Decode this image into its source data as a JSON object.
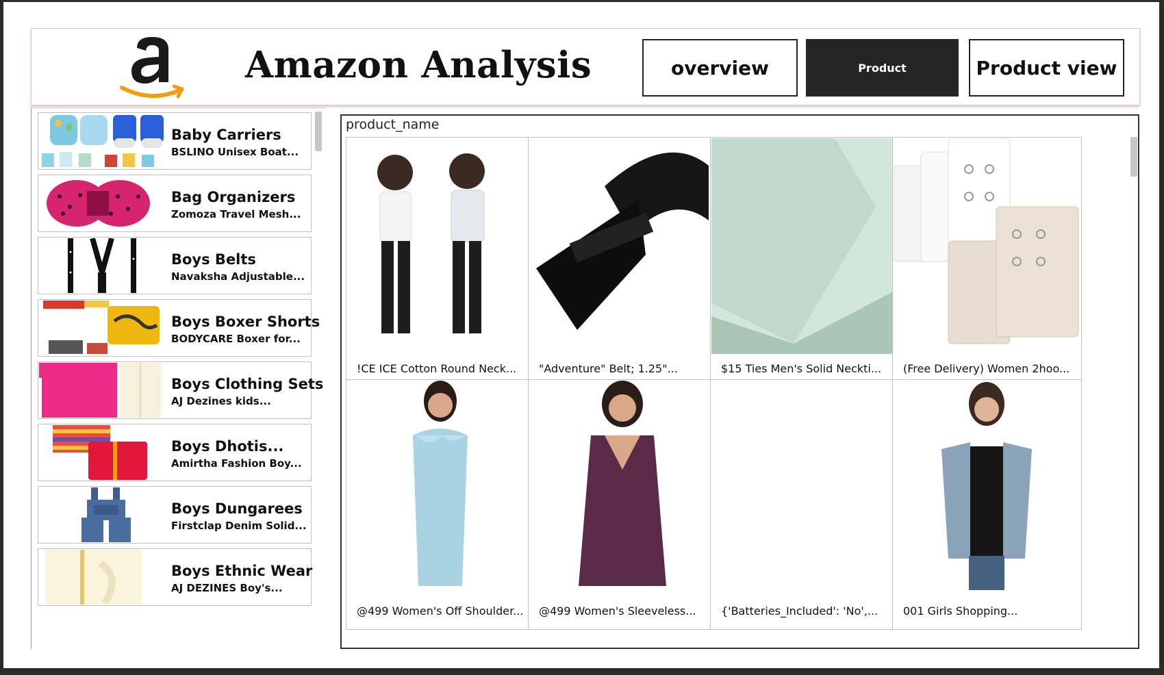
{
  "header": {
    "title": "Amazon Analysis",
    "nav": {
      "overview": "overview",
      "product": "Product",
      "product_view": "Product view"
    }
  },
  "colors": {
    "amazon_orange": "#f39c12",
    "active_tab_bg": "#252525",
    "text": "#111111"
  },
  "slicer": {
    "items": [
      {
        "category": "Baby Carriers",
        "product": "BSLINO Unisex Boat..."
      },
      {
        "category": "Bag Organizers",
        "product": "Zomoza Travel Mesh..."
      },
      {
        "category": "Boys Belts",
        "product": "Navaksha Adjustable..."
      },
      {
        "category": "Boys Boxer Shorts",
        "product": "BODYCARE Boxer for..."
      },
      {
        "category": "Boys Clothing Sets",
        "product": "AJ Dezines kids..."
      },
      {
        "category": "Boys Dhotis...",
        "product": "Amirtha Fashion Boy..."
      },
      {
        "category": "Boys Dungarees",
        "product": "Firstclap Denim Solid..."
      },
      {
        "category": "Boys Ethnic Wear",
        "product": "AJ DEZINES Boy's..."
      }
    ]
  },
  "gallery": {
    "label": "product_name",
    "cards": [
      {
        "caption": "!CE ICE Cotton Round Neck...",
        "icon": "girls-tshirt-image"
      },
      {
        "caption": "\"Adventure\" Belt; 1.25\"...",
        "icon": "black-belt-image"
      },
      {
        "caption": "$15 Ties Men's Solid Neckti...",
        "icon": "mint-tie-image"
      },
      {
        "caption": "(Free Delivery) Women 2hoo...",
        "icon": "bra-extender-image"
      },
      {
        "caption": "@499 Women's Off Shoulder...",
        "icon": "blue-dress-image"
      },
      {
        "caption": "@499 Women's Sleeveless...",
        "icon": "purple-dress-image"
      },
      {
        "caption": "{'Batteries_Included': 'No',...",
        "icon": "blank-image"
      },
      {
        "caption": "001 Girls Shopping...",
        "icon": "denim-vest-image"
      }
    ]
  }
}
